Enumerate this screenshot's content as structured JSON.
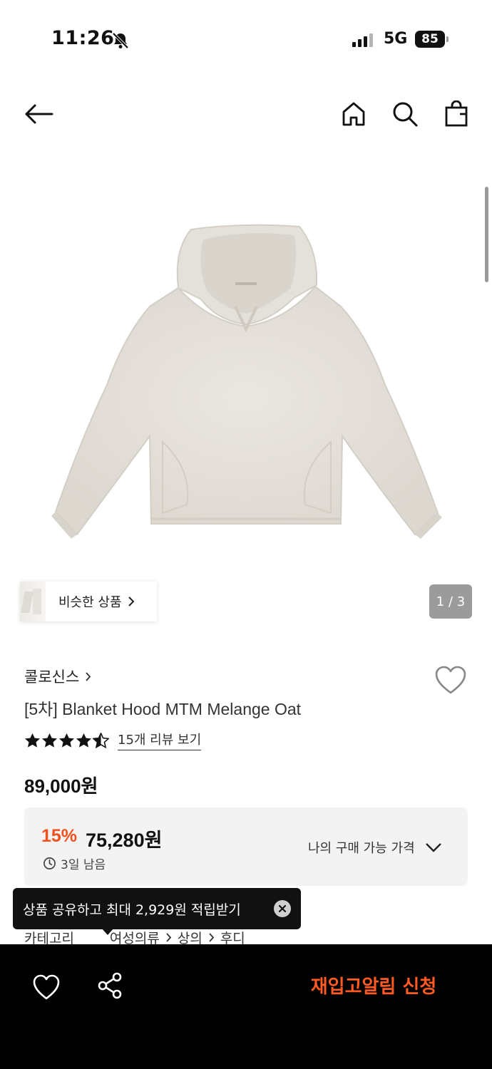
{
  "status_bar": {
    "time": "11:26",
    "network": "5G",
    "battery": "85",
    "icons": [
      "bell-slash-icon",
      "signal-icon",
      "battery-icon"
    ]
  },
  "nav": {
    "icons": [
      "back-arrow-icon",
      "home-icon",
      "search-icon",
      "shopping-bag-icon"
    ]
  },
  "gallery": {
    "image": "oatmeal-melange-hoodie",
    "similar_label": "비슷한 상품",
    "page_counter": "1 / 3"
  },
  "product": {
    "brand": "콜로신스",
    "title": "[5차] Blanket Hood MTM Melange Oat",
    "rating": 4.5,
    "review_link": "15개 리뷰 보기",
    "original_price": "89,000원"
  },
  "discount": {
    "rate": "15%",
    "sale_price": "75,280원",
    "time_left": "3일 남음",
    "my_price_label": "나의 구매 가능 가격"
  },
  "category": {
    "label": "카테고리",
    "path": [
      "여성의류",
      "상의",
      "후디"
    ]
  },
  "toast": {
    "text": "상품 공유하고 최대 2,929원 적립받기"
  },
  "bottom_bar": {
    "restock_label": "재입고알림 신청"
  },
  "colors": {
    "accent": "#f0501e",
    "cta": "#ff5a24",
    "bar": "#000000",
    "box": "#f3f3f4"
  }
}
